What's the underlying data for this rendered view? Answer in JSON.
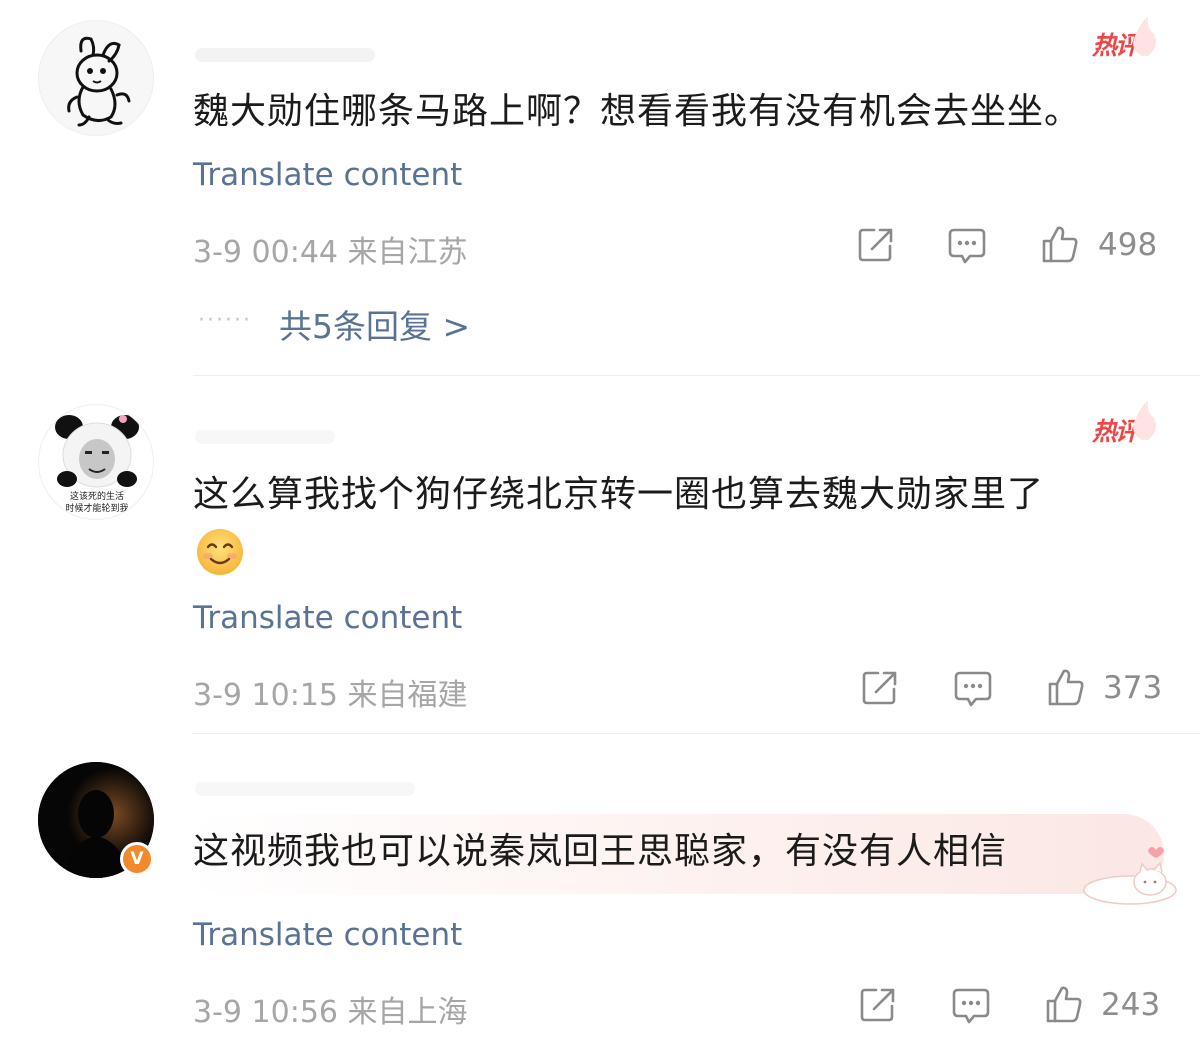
{
  "comments": [
    {
      "hot_label": "热评",
      "text": "魏大勋住哪条马路上啊？想看看我有没有机会去坐坐。",
      "translate": "Translate content",
      "time": "3-9 00:44",
      "location": "来自江苏",
      "likes": "498",
      "replies_dots": "······",
      "replies": "共5条回复 >"
    },
    {
      "hot_label": "热评",
      "text": "这么算我找个狗仔绕北京转一圈也算去魏大勋家里了",
      "emoji": "smiling-face",
      "translate": "Translate content",
      "time": "3-9 10:15",
      "location": "来自福建",
      "likes": "373",
      "avatar_caption": [
        "这该死的生活",
        "时候才能轮到我"
      ]
    },
    {
      "text": "这视频我也可以说秦岚回王思聪家，有没有人相信",
      "translate": "Translate content",
      "time": "3-9 10:56",
      "location": "来自上海",
      "likes": "243",
      "verified_badge": "V"
    }
  ],
  "icons": {
    "share": "share-icon",
    "comment": "comment-icon",
    "like": "thumbs-up-icon"
  },
  "colors": {
    "hot": "#f04545",
    "link": "#5a7394",
    "meta": "#a6a6a6",
    "verified": "#f18a2a"
  }
}
